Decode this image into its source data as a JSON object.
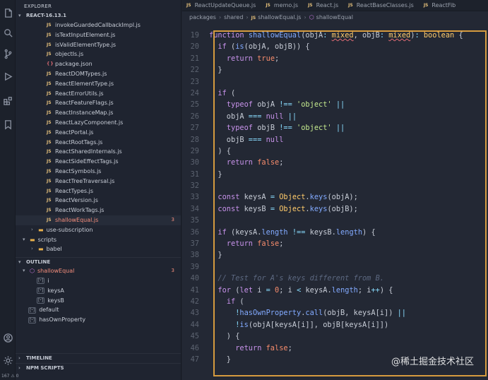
{
  "sidebar": {
    "title": "EXPLORER",
    "project": "REACT-16.13.1",
    "files": [
      {
        "type": "js",
        "name": "invokeGuardedCallbackImpl.js"
      },
      {
        "type": "js",
        "name": "isTextInputElement.js"
      },
      {
        "type": "js",
        "name": "isValidElementType.js"
      },
      {
        "type": "js",
        "name": "objectIs.js"
      },
      {
        "type": "json",
        "name": "package.json"
      },
      {
        "type": "js",
        "name": "ReactDOMTypes.js"
      },
      {
        "type": "js",
        "name": "ReactElementType.js"
      },
      {
        "type": "js",
        "name": "ReactErrorUtils.js"
      },
      {
        "type": "js",
        "name": "ReactFeatureFlags.js"
      },
      {
        "type": "js",
        "name": "ReactInstanceMap.js"
      },
      {
        "type": "js",
        "name": "ReactLazyComponent.js"
      },
      {
        "type": "js",
        "name": "ReactPortal.js"
      },
      {
        "type": "js",
        "name": "ReactRootTags.js"
      },
      {
        "type": "js",
        "name": "ReactSharedInternals.js"
      },
      {
        "type": "js",
        "name": "ReactSideEffectTags.js"
      },
      {
        "type": "js",
        "name": "ReactSymbols.js"
      },
      {
        "type": "js",
        "name": "ReactTreeTraversal.js"
      },
      {
        "type": "js",
        "name": "ReactTypes.js"
      },
      {
        "type": "js",
        "name": "ReactVersion.js"
      },
      {
        "type": "js",
        "name": "ReactWorkTags.js"
      },
      {
        "type": "js",
        "name": "shallowEqual.js",
        "badge": "3"
      }
    ],
    "folders": [
      "use-subscription",
      "scripts",
      "babel"
    ],
    "outline_title": "OUTLINE",
    "outline": {
      "root": "shallowEqual",
      "root_badge": "3",
      "children": [
        "i",
        "keysA",
        "keysB"
      ],
      "siblings": [
        "default",
        "hasOwnProperty"
      ]
    },
    "timeline": "TIMELINE",
    "npm_scripts": "NPM SCRIPTS",
    "status": "167 ⚠ 0"
  },
  "tabs": [
    "ReactUpdateQueue.js",
    "memo.js",
    "React.js",
    "ReactBaseClasses.js",
    "ReactFib"
  ],
  "breadcrumb": [
    "packages",
    "shared",
    "shallowEqual.js",
    "shallowEqual"
  ],
  "watermark": "@稀土掘金技术社区",
  "accent_color": "#d59b3f",
  "line_numbers": [
    "19",
    "20",
    "21",
    "22",
    "23",
    "24",
    "25",
    "26",
    "27",
    "28",
    "29",
    "30",
    "31",
    "32",
    "33",
    "34",
    "35",
    "36",
    "37",
    "38",
    "39",
    "40",
    "41",
    "42",
    "43",
    "44",
    "45",
    "46",
    "47"
  ]
}
